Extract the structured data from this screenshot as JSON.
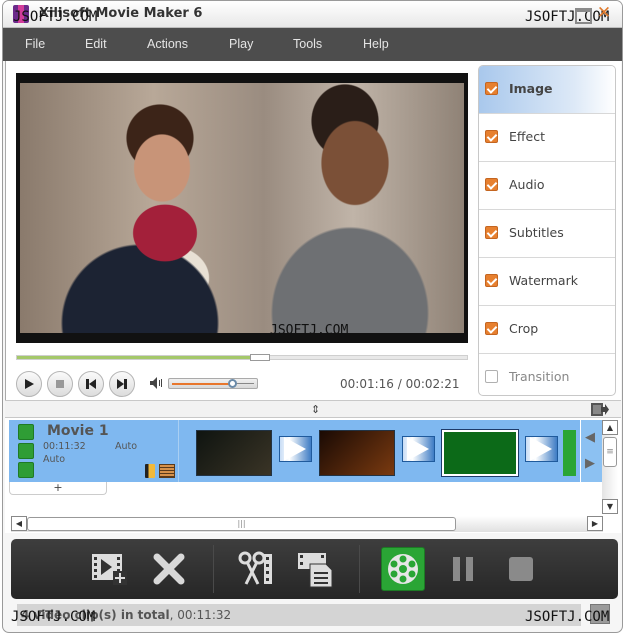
{
  "app": {
    "title": "Xilisoft Movie Maker 6",
    "watermark": "JSOFTJ.COM"
  },
  "menu": [
    "File",
    "Edit",
    "Actions",
    "Play",
    "Tools",
    "Help"
  ],
  "player": {
    "current_time": "00:01:16",
    "total_time": "00:02:21",
    "time_display": "00:01:16 / 00:02:21",
    "seek_progress_percent": 54,
    "volume_percent": 74,
    "buttons": [
      "play",
      "stop",
      "previous",
      "next"
    ]
  },
  "side_panel": {
    "items": [
      {
        "label": "Image",
        "checked": true,
        "active": true
      },
      {
        "label": "Effect",
        "checked": true,
        "active": false
      },
      {
        "label": "Audio",
        "checked": true,
        "active": false
      },
      {
        "label": "Subtitles",
        "checked": true,
        "active": false
      },
      {
        "label": "Watermark",
        "checked": true,
        "active": false
      },
      {
        "label": "Crop",
        "checked": true,
        "active": false
      },
      {
        "label": "Transition",
        "checked": false,
        "active": false
      }
    ]
  },
  "timeline": {
    "track": {
      "name": "Movie 1",
      "duration": "00:11:32",
      "mode": "Auto",
      "audio_mode": "Auto"
    },
    "add_label": "+",
    "clips": [
      {
        "name": "clip-1",
        "colors": [
          "#0f1410",
          "#3a3426"
        ]
      },
      {
        "name": "clip-2",
        "colors": [
          "#1a0a04",
          "#7a3a10"
        ]
      },
      {
        "name": "clip-3",
        "colors": [
          "#0c6a18",
          "#0c6a18"
        ]
      }
    ]
  },
  "toolbar": {
    "buttons": [
      "add-video",
      "remove",
      "clip",
      "merge",
      "convert",
      "pause",
      "stop"
    ]
  },
  "status": {
    "count_text": "4 video clip(s) in total",
    "duration": "00:11:32"
  }
}
